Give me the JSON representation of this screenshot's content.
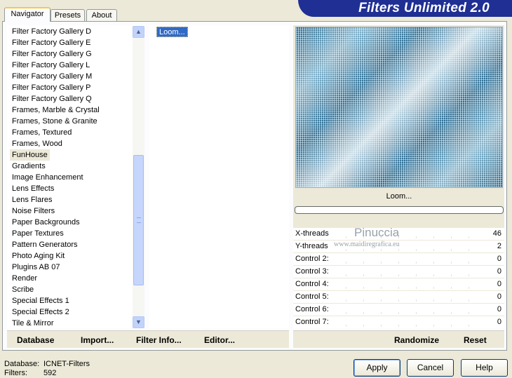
{
  "header": {
    "title": "Filters Unlimited 2.0"
  },
  "tabs": [
    {
      "label": "Navigator",
      "active": true
    },
    {
      "label": "Presets",
      "active": false
    },
    {
      "label": "About",
      "active": false
    }
  ],
  "categories": {
    "items": [
      "Filter Factory Gallery D",
      "Filter Factory Gallery E",
      "Filter Factory Gallery G",
      "Filter Factory Gallery L",
      "Filter Factory Gallery M",
      "Filter Factory Gallery P",
      "Filter Factory Gallery Q",
      "Frames, Marble & Crystal",
      "Frames, Stone & Granite",
      "Frames, Textured",
      "Frames, Wood",
      "FunHouse",
      "Gradients",
      "Image Enhancement",
      "Lens Effects",
      "Lens Flares",
      "Noise Filters",
      "Paper Backgrounds",
      "Paper Textures",
      "Pattern Generators",
      "Photo Aging Kit",
      "Plugins AB 07",
      "Render",
      "Scribe",
      "Special Effects 1",
      "Special Effects 2",
      "Tile & Mirror"
    ],
    "selected": "FunHouse"
  },
  "filters": {
    "items": [
      "Loom..."
    ],
    "selected": "Loom..."
  },
  "preview": {
    "filter_name": "Loom...",
    "progress": 0
  },
  "controls": [
    {
      "label": "X-threads",
      "value": "46"
    },
    {
      "label": "Y-threads",
      "value": "2"
    },
    {
      "label": "Control 2:",
      "value": "0"
    },
    {
      "label": "Control 3:",
      "value": "0"
    },
    {
      "label": "Control 4:",
      "value": "0"
    },
    {
      "label": "Control 5:",
      "value": "0"
    },
    {
      "label": "Control 6:",
      "value": "0"
    },
    {
      "label": "Control 7:",
      "value": "0"
    }
  ],
  "watermark": {
    "name": "Pinuccia",
    "url": "www.maidiregrafica.eu"
  },
  "left_actions": [
    "Database",
    "Import...",
    "Filter Info...",
    "Editor..."
  ],
  "right_actions": [
    "Randomize",
    "Reset"
  ],
  "footer": {
    "database_label": "Database:",
    "database_value": "ICNET-Filters",
    "filters_label": "Filters:",
    "filters_value": "592"
  },
  "buttons": {
    "apply": "Apply",
    "cancel": "Cancel",
    "help": "Help"
  },
  "colors": {
    "header_bg": "#1f2f94",
    "selection": "#316ac5",
    "preview_blue": "#2a6a8e"
  }
}
